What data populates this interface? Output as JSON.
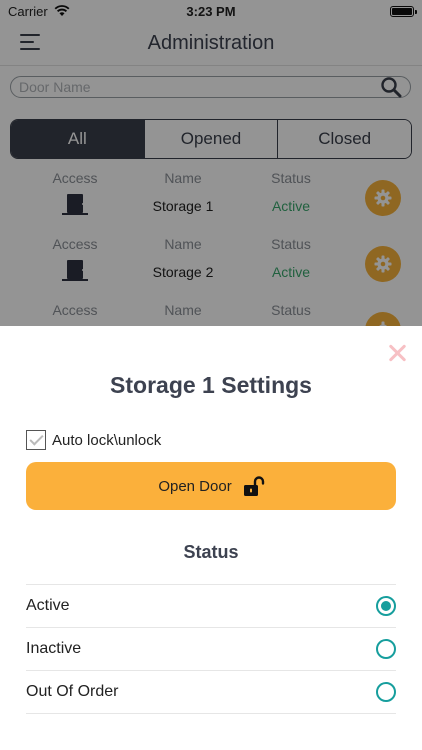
{
  "statusbar": {
    "carrier": "Carrier",
    "time": "3:23 PM"
  },
  "header": {
    "title": "Administration"
  },
  "search": {
    "placeholder": "Door Name"
  },
  "tabs": [
    {
      "label": "All",
      "active": true
    },
    {
      "label": "Opened",
      "active": false
    },
    {
      "label": "Closed",
      "active": false
    }
  ],
  "columns": {
    "access": "Access",
    "name": "Name",
    "status": "Status"
  },
  "doors": [
    {
      "name": "Storage 1",
      "status": "Active"
    },
    {
      "name": "Storage 2",
      "status": "Active"
    }
  ],
  "sheet": {
    "title": "Storage 1 Settings",
    "autolock_label": "Auto lock\\unlock",
    "open_door_label": "Open Door",
    "status_title": "Status",
    "options": [
      {
        "label": "Active",
        "selected": true
      },
      {
        "label": "Inactive",
        "selected": false
      },
      {
        "label": "Out Of Order",
        "selected": false
      }
    ]
  },
  "colors": {
    "accent": "#fbb03b",
    "dark": "#3a3f4b",
    "active_status": "#3aa76d",
    "radio": "#169e9d"
  }
}
